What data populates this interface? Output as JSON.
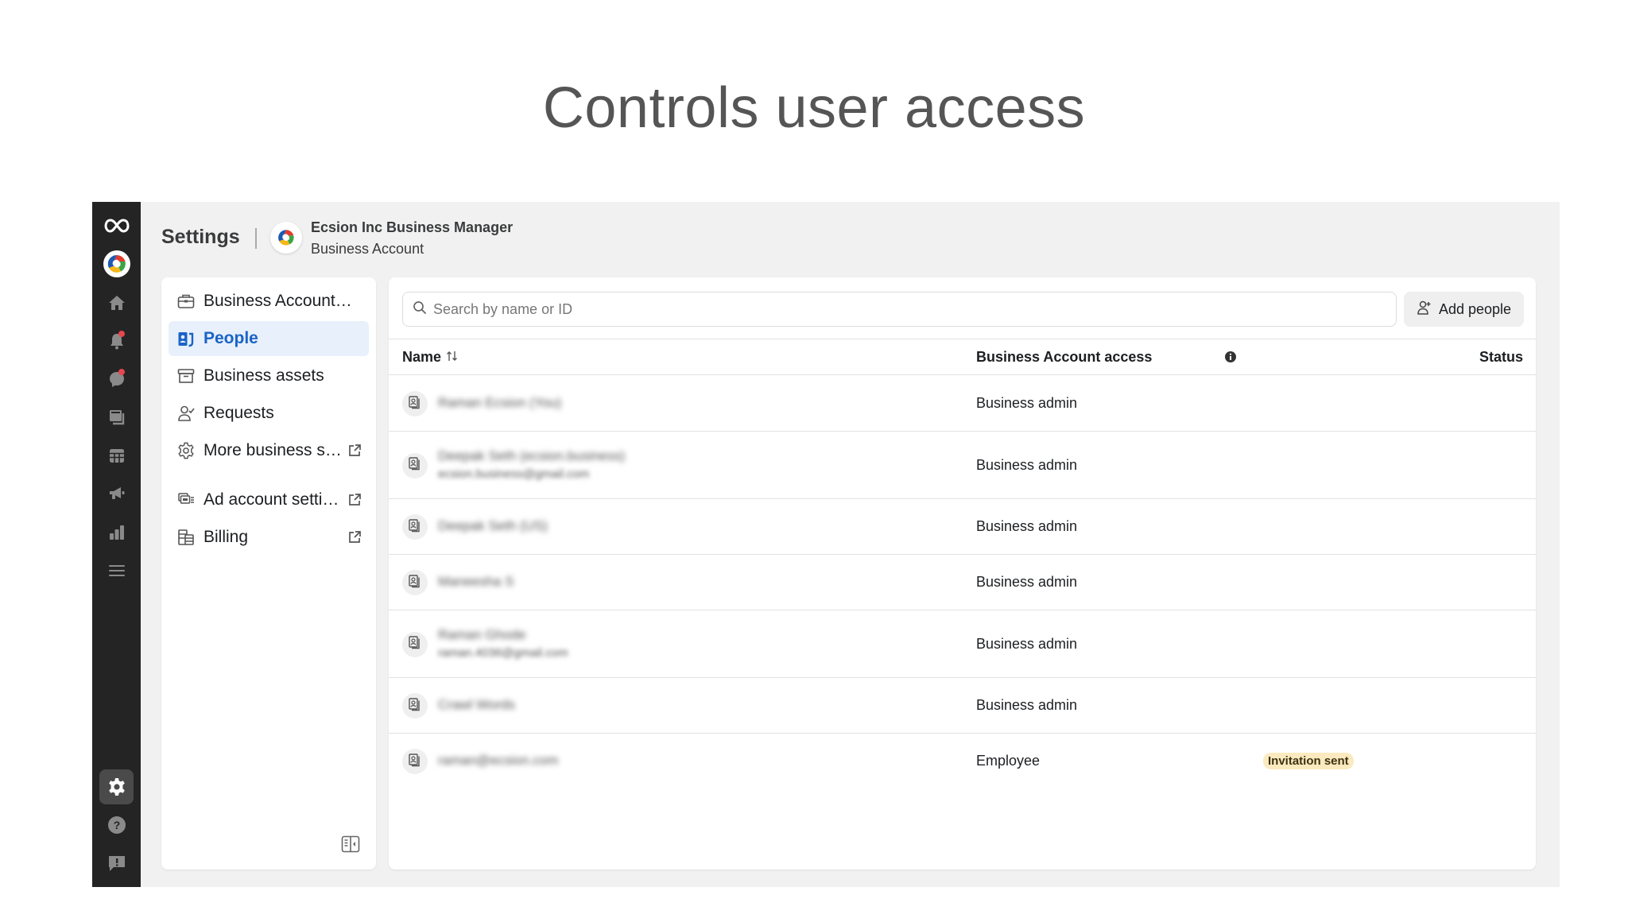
{
  "slide": {
    "title": "Controls user access"
  },
  "rail": {
    "items": [
      {
        "icon": "meta-logo-icon"
      },
      {
        "icon": "business-logo-icon"
      },
      {
        "icon": "home-icon"
      },
      {
        "icon": "notifications-icon",
        "has_badge": true
      },
      {
        "icon": "messages-icon",
        "has_badge": true
      },
      {
        "icon": "pages-icon"
      },
      {
        "icon": "table-icon"
      },
      {
        "icon": "ads-megaphone-icon"
      },
      {
        "icon": "insights-icon"
      },
      {
        "icon": "menu-icon"
      },
      {
        "icon": "settings-gear-icon",
        "active": true
      },
      {
        "icon": "help-icon"
      },
      {
        "icon": "report-problem-icon"
      }
    ]
  },
  "header": {
    "title": "Settings",
    "business_name": "Ecsion Inc Business Manager",
    "business_type": "Business Account"
  },
  "nav": {
    "items": [
      {
        "label": "Business Account…",
        "icon": "briefcase-icon",
        "external": false
      },
      {
        "label": "People",
        "icon": "people-badge-icon",
        "external": false,
        "active": true
      },
      {
        "label": "Business assets",
        "icon": "archive-box-icon",
        "external": false
      },
      {
        "label": "Requests",
        "icon": "person-check-icon",
        "external": false
      },
      {
        "label": "More business s…",
        "icon": "gear-icon",
        "external": true
      },
      {
        "label": "Ad account setti…",
        "icon": "ad-account-icon",
        "external": true
      },
      {
        "label": "Billing",
        "icon": "billing-stack-icon",
        "external": true
      }
    ]
  },
  "toolbar": {
    "search_placeholder": "Search by name or ID",
    "search_value": "",
    "add_label": "Add people"
  },
  "table": {
    "columns": {
      "name": "Name",
      "access": "Business Account access",
      "status": "Status"
    },
    "rows": [
      {
        "name": "Raman Ecsion (You)",
        "email": "",
        "access": "Business admin",
        "status": ""
      },
      {
        "name": "Deepak Seth (ecsion.business)",
        "email": "ecsion.business@gmail.com",
        "access": "Business admin",
        "status": ""
      },
      {
        "name": "Deepak Seth (US)",
        "email": "",
        "access": "Business admin",
        "status": ""
      },
      {
        "name": "Maneesha S",
        "email": "",
        "access": "Business admin",
        "status": ""
      },
      {
        "name": "Raman Ghode",
        "email": "raman.4036@gmail.com",
        "access": "Business admin",
        "status": ""
      },
      {
        "name": "Crawl Words",
        "email": "",
        "access": "Business admin",
        "status": ""
      },
      {
        "name": "raman@ecsion.com",
        "email": "",
        "access": "Employee",
        "status": "Invitation sent"
      }
    ]
  },
  "colors": {
    "rail_bg": "#242424",
    "active_nav_bg": "#e7f0fb",
    "active_nav_text": "#1b63c6",
    "badge_bg": "#fbeabf",
    "notification_dot": "#e4474e"
  }
}
